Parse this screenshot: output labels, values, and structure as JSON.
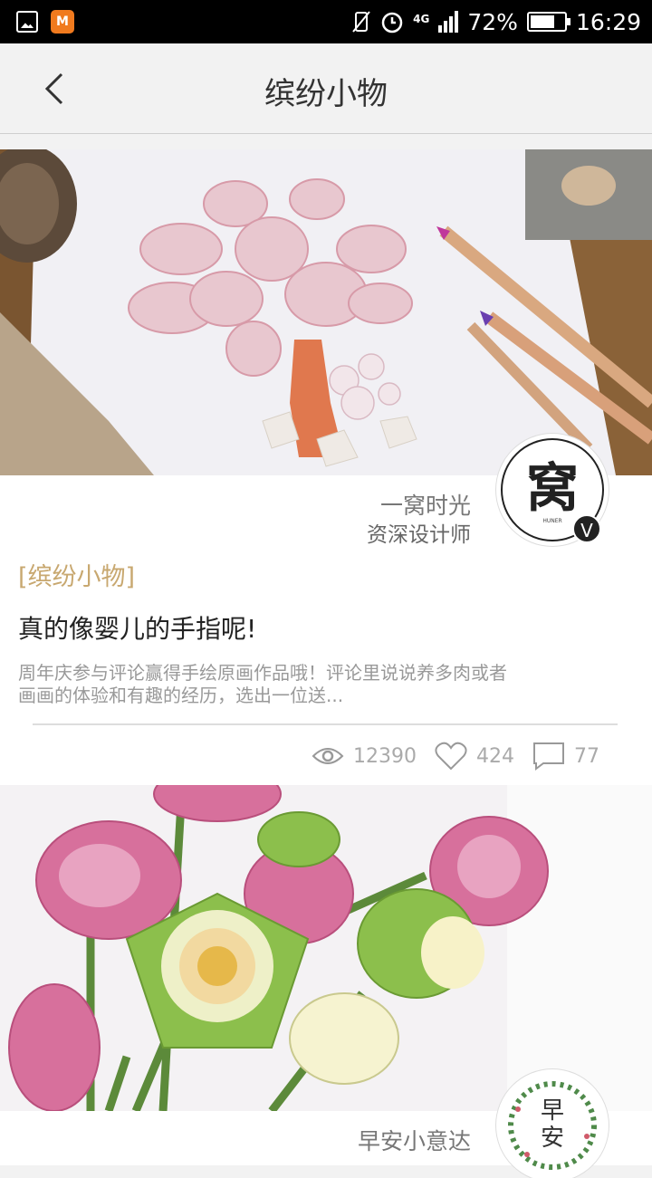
{
  "status_bar": {
    "battery_percent": "72%",
    "battery_level": 0.72,
    "time": "16:29",
    "network": "4G",
    "icons": [
      "image-icon",
      "mango-tv-icon",
      "vibrate-icon",
      "alarm-icon",
      "signal-icon",
      "battery-icon"
    ]
  },
  "nav": {
    "title": "缤纷小物",
    "back_icon": "chevron-left-icon"
  },
  "cards": [
    {
      "image": "succulent-drawing-photo",
      "author_name": "一窝时光",
      "author_role": "资深设计师",
      "avatar_text": "窝",
      "avatar_sub": "HUNER",
      "verified_badge": "V",
      "category": "[缤纷小物]",
      "title": "真的像婴儿的手指呢!",
      "excerpt_line1": "周年庆参与评论赢得手绘原画作品哦！评论里说说养多肉或者",
      "excerpt_line2": "画画的体验和有趣的经历，选出一位送...",
      "views": "12390",
      "likes": "424",
      "comments": "77"
    },
    {
      "image": "lotus-flowers-photo",
      "author_name": "早安小意达",
      "avatar_text_top": "早",
      "avatar_text_bottom": "安"
    }
  ],
  "colors": {
    "category": "#c8a870",
    "background": "#f2f2f2",
    "statusbar": "#000000"
  }
}
